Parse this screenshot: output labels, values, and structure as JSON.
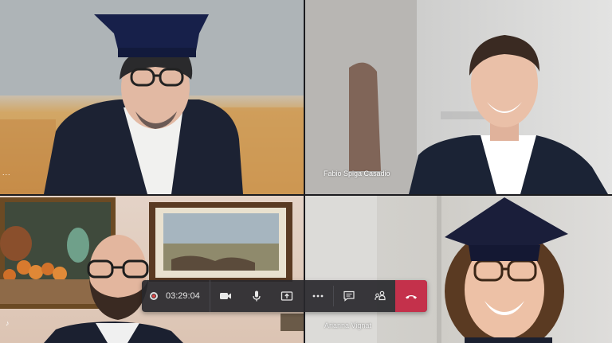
{
  "participants": [
    {
      "id": "p1",
      "name": "",
      "overflow_label": "..."
    },
    {
      "id": "p2",
      "name": "Fabio Spiga Casadio"
    },
    {
      "id": "p3",
      "name": ""
    },
    {
      "id": "p4",
      "name": "Arianna Vignat"
    }
  ],
  "toolbar": {
    "call_duration": "03:29:04",
    "buttons": [
      "video-camera-icon",
      "microphone-icon",
      "share-screen-icon",
      "more-options-icon",
      "chat-icon",
      "participants-icon",
      "hang-up-icon"
    ]
  },
  "colors": {
    "hangup": "#c4314b",
    "toolbar_bg": "#28282c",
    "record": "#e04545"
  }
}
